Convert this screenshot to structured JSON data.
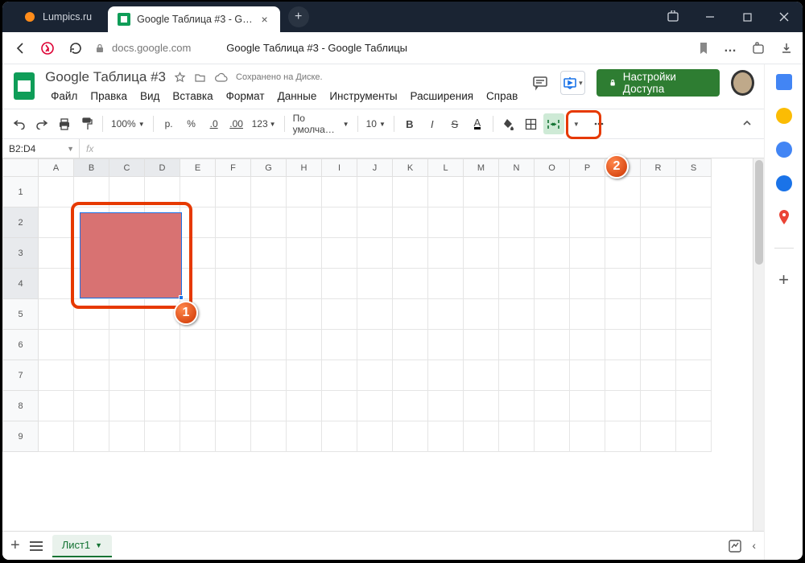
{
  "titlebar": {
    "inactive_tab": "Lumpics.ru",
    "active_tab": "Google Таблица #3 - G…",
    "close": "×",
    "newtab": "+"
  },
  "addressbar": {
    "url": "docs.google.com",
    "page_title": "Google Таблица #3 - Google Таблицы",
    "more": "…"
  },
  "doc": {
    "title": "Google Таблица #3",
    "saved": "Сохранено на Диске."
  },
  "menus": [
    "Файл",
    "Правка",
    "Вид",
    "Вставка",
    "Формат",
    "Данные",
    "Инструменты",
    "Расширения",
    "Справ"
  ],
  "share_label": "Настройки Доступа",
  "toolbar": {
    "zoom": "100%",
    "currency": "р.",
    "percent": "%",
    "dec_dec": ".0",
    "inc_dec": ".00",
    "numfmt": "123",
    "font": "По умолча…",
    "fontsize": "10"
  },
  "namebox": "B2:D4",
  "fx": "fx",
  "columns": [
    "A",
    "B",
    "C",
    "D",
    "E",
    "F",
    "G",
    "H",
    "I",
    "J",
    "K",
    "L",
    "M",
    "N",
    "O",
    "P",
    "Q",
    "R",
    "S"
  ],
  "rows": [
    "1",
    "2",
    "3",
    "4",
    "5",
    "6",
    "7",
    "8",
    "9"
  ],
  "sheet_tab": "Лист1",
  "callouts": {
    "one": "1",
    "two": "2"
  }
}
